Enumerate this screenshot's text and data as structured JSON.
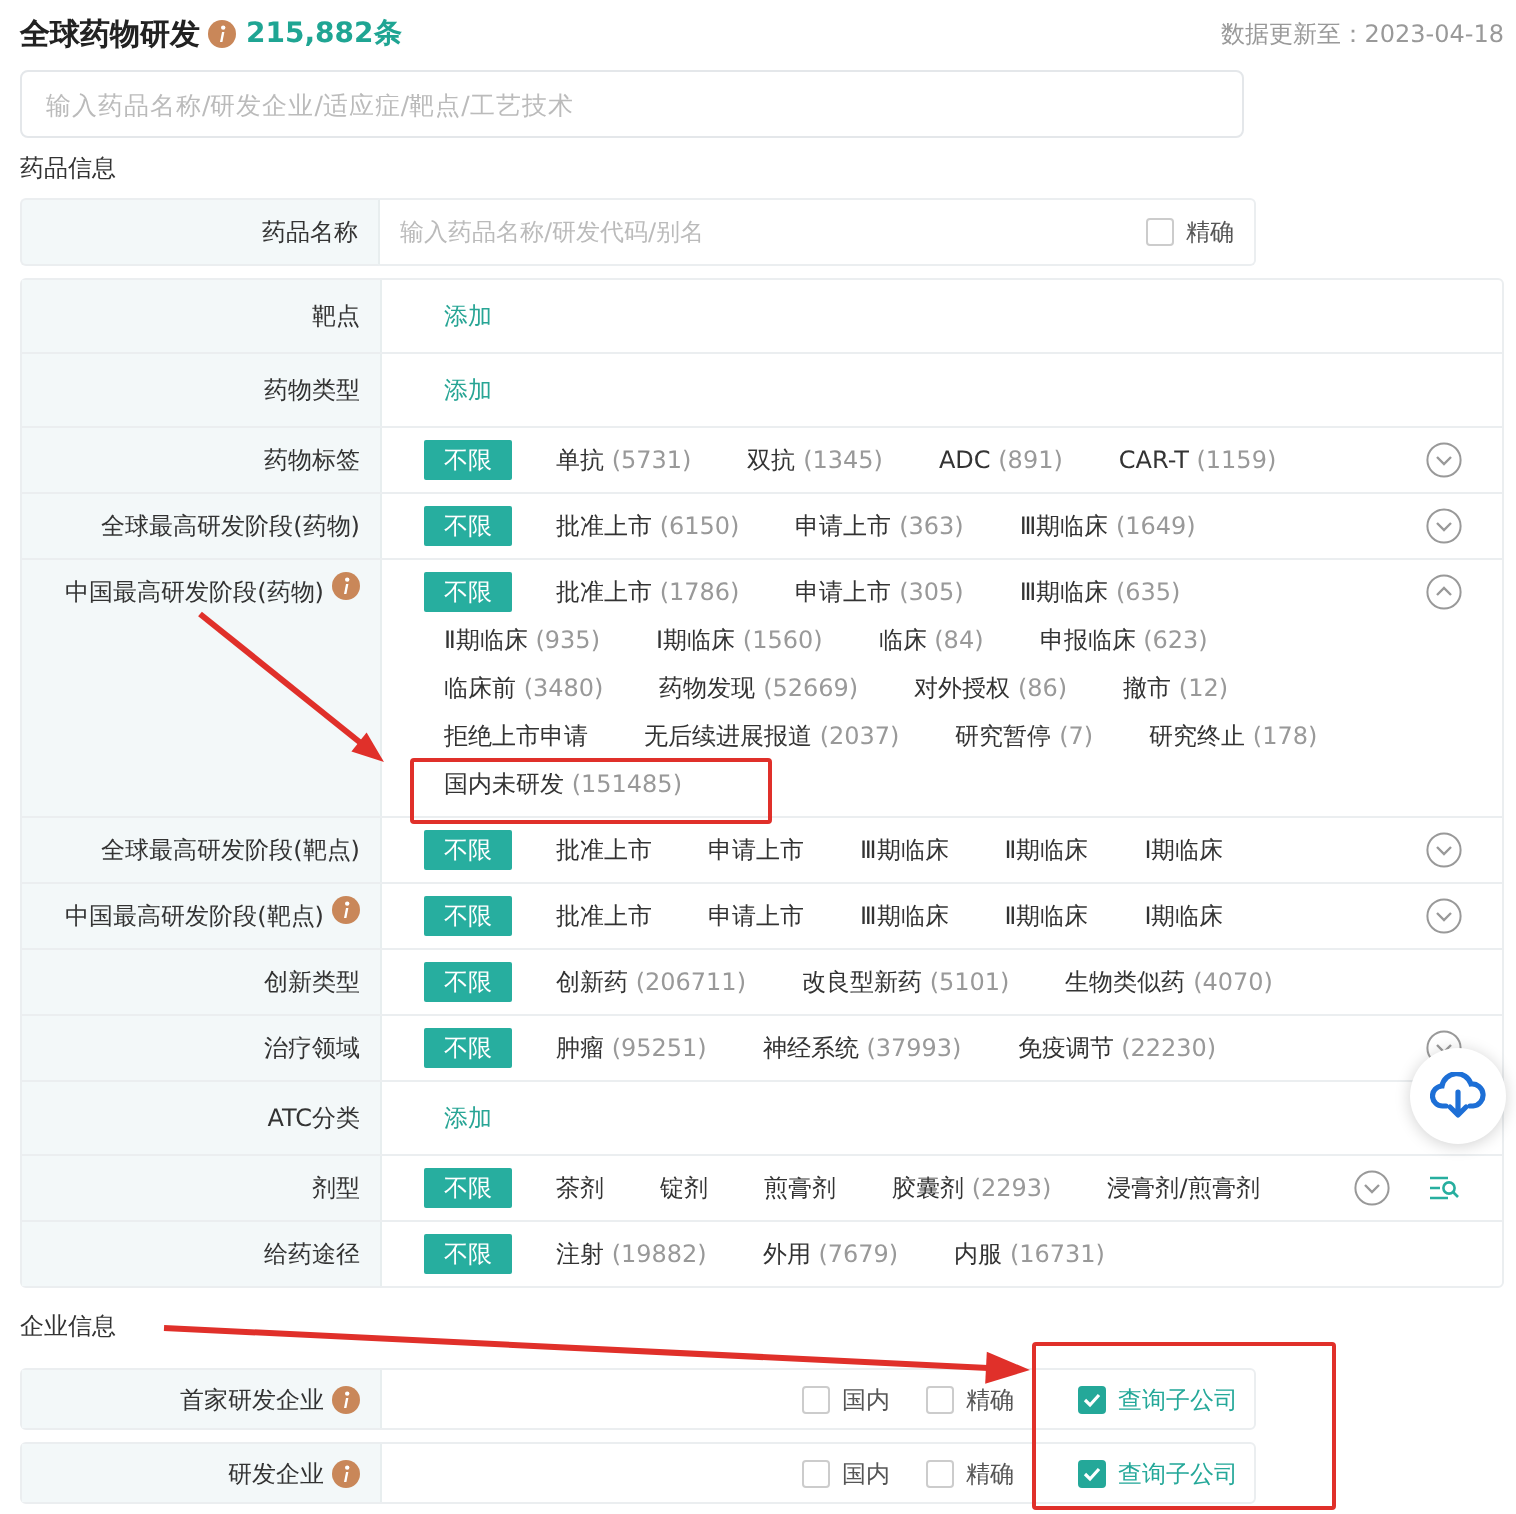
{
  "header": {
    "title": "全球药物研发",
    "info": true,
    "count": "215,882条",
    "updated": "数据更新至：2023-04-18"
  },
  "search": {
    "placeholder": "输入药品名称/研发企业/适应症/靶点/工艺技术"
  },
  "drug_section": {
    "title": "药品信息",
    "name_row": {
      "label": "药品名称",
      "placeholder": "输入药品名称/研发代码/别名",
      "exact": {
        "label": "精确",
        "checked": false
      }
    },
    "filters": [
      {
        "label": "靶点",
        "kind": "add",
        "action": "添加"
      },
      {
        "label": "药物类型",
        "kind": "add",
        "action": "添加"
      },
      {
        "label": "药物标签",
        "kind": "options",
        "all": {
          "label": "不限",
          "selected": true
        },
        "expanded": false,
        "lines": [
          [
            {
              "label": "单抗",
              "count": "(5731)"
            },
            {
              "label": "双抗",
              "count": "(1345)"
            },
            {
              "label": "ADC",
              "count": "(891)"
            },
            {
              "label": "CAR-T",
              "count": "(1159)"
            }
          ]
        ]
      },
      {
        "label": "全球最高研发阶段(药物)",
        "kind": "options",
        "all": {
          "label": "不限",
          "selected": true
        },
        "expanded": false,
        "lines": [
          [
            {
              "label": "批准上市",
              "count": "(6150)"
            },
            {
              "label": "申请上市",
              "count": "(363)"
            },
            {
              "label": "Ⅲ期临床",
              "count": "(1649)"
            }
          ]
        ]
      },
      {
        "label": "中国最高研发阶段(药物)",
        "kind": "options",
        "info": true,
        "all": {
          "label": "不限",
          "selected": true
        },
        "expanded": true,
        "lines": [
          [
            {
              "label": "批准上市",
              "count": "(1786)"
            },
            {
              "label": "申请上市",
              "count": "(305)"
            },
            {
              "label": "Ⅲ期临床",
              "count": "(635)"
            }
          ],
          [
            {
              "label": "Ⅱ期临床",
              "count": "(935)"
            },
            {
              "label": "Ⅰ期临床",
              "count": "(1560)"
            },
            {
              "label": "临床",
              "count": "(84)"
            },
            {
              "label": "申报临床",
              "count": "(623)"
            }
          ],
          [
            {
              "label": "临床前",
              "count": "(3480)"
            },
            {
              "label": "药物发现",
              "count": "(52669)"
            },
            {
              "label": "对外授权",
              "count": "(86)"
            },
            {
              "label": "撤市",
              "count": "(12)"
            }
          ],
          [
            {
              "label": "拒绝上市申请"
            },
            {
              "label": "无后续进展报道",
              "count": "(2037)"
            },
            {
              "label": "研究暂停",
              "count": "(7)"
            },
            {
              "label": "研究终止",
              "count": "(178)"
            }
          ],
          [
            {
              "label": "国内未研发",
              "count": "(151485)",
              "highlighted": true
            }
          ]
        ]
      },
      {
        "label": "全球最高研发阶段(靶点)",
        "kind": "options",
        "all": {
          "label": "不限",
          "selected": true
        },
        "expanded": false,
        "lines": [
          [
            {
              "label": "批准上市"
            },
            {
              "label": "申请上市"
            },
            {
              "label": "Ⅲ期临床"
            },
            {
              "label": "Ⅱ期临床"
            },
            {
              "label": "Ⅰ期临床"
            }
          ]
        ]
      },
      {
        "label": "中国最高研发阶段(靶点)",
        "kind": "options",
        "info": true,
        "all": {
          "label": "不限",
          "selected": true
        },
        "expanded": false,
        "lines": [
          [
            {
              "label": "批准上市"
            },
            {
              "label": "申请上市"
            },
            {
              "label": "Ⅲ期临床"
            },
            {
              "label": "Ⅱ期临床"
            },
            {
              "label": "Ⅰ期临床"
            }
          ]
        ]
      },
      {
        "label": "创新类型",
        "kind": "options",
        "all": {
          "label": "不限",
          "selected": true
        },
        "lines": [
          [
            {
              "label": "创新药",
              "count": "(206711)"
            },
            {
              "label": "改良型新药",
              "count": "(5101)"
            },
            {
              "label": "生物类似药",
              "count": "(4070)"
            }
          ]
        ]
      },
      {
        "label": "治疗领域",
        "kind": "options",
        "all": {
          "label": "不限",
          "selected": true
        },
        "expanded": false,
        "lines": [
          [
            {
              "label": "肿瘤",
              "count": "(95251)"
            },
            {
              "label": "神经系统",
              "count": "(37993)"
            },
            {
              "label": "免疫调节",
              "count": "(22230)"
            }
          ]
        ]
      },
      {
        "label": "ATC分类",
        "kind": "add",
        "action": "添加"
      },
      {
        "label": "剂型",
        "kind": "options",
        "all": {
          "label": "不限",
          "selected": true
        },
        "expanded": false,
        "search_tool": true,
        "lines": [
          [
            {
              "label": "茶剂"
            },
            {
              "label": "锭剂"
            },
            {
              "label": "煎膏剂"
            },
            {
              "label": "胶囊剂",
              "count": "(2293)"
            },
            {
              "label": "浸膏剂/煎膏剂"
            }
          ]
        ]
      },
      {
        "label": "给药途径",
        "kind": "options",
        "all": {
          "label": "不限",
          "selected": true
        },
        "lines": [
          [
            {
              "label": "注射",
              "count": "(19882)"
            },
            {
              "label": "外用",
              "count": "(7679)"
            },
            {
              "label": "内服",
              "count": "(16731)"
            }
          ]
        ]
      }
    ]
  },
  "company_section": {
    "title": "企业信息",
    "rows": [
      {
        "label": "首家研发企业",
        "info": true,
        "options": [
          {
            "label": "国内",
            "checked": false
          },
          {
            "label": "精确",
            "checked": false
          },
          {
            "label": "查询子公司",
            "checked": true,
            "highlighted": true
          }
        ]
      },
      {
        "label": "研发企业",
        "info": true,
        "options": [
          {
            "label": "国内",
            "checked": false
          },
          {
            "label": "精确",
            "checked": false
          },
          {
            "label": "查询子公司",
            "checked": true,
            "highlighted": true
          }
        ]
      }
    ]
  }
}
